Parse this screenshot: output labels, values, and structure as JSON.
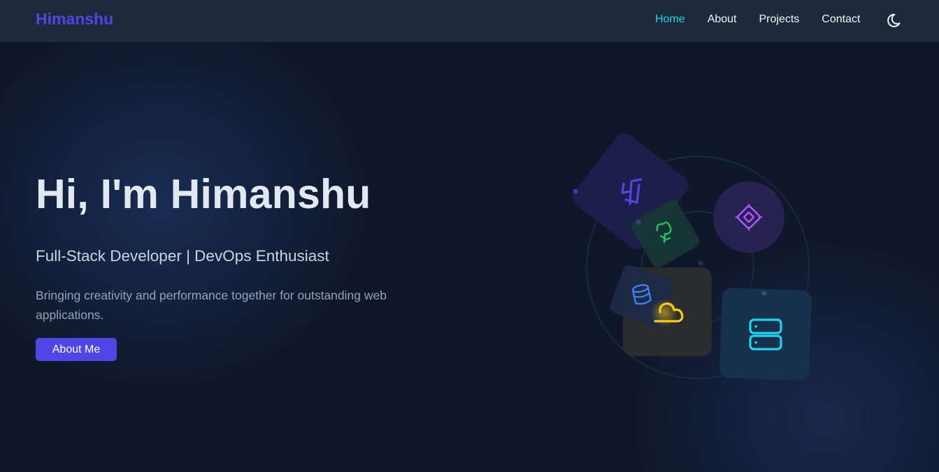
{
  "navbar": {
    "brand": "Himanshu",
    "links": [
      {
        "label": "Home",
        "active": true
      },
      {
        "label": "About",
        "active": false
      },
      {
        "label": "Projects",
        "active": false
      },
      {
        "label": "Contact",
        "active": false
      }
    ],
    "theme_toggle_icon": "moon-icon"
  },
  "hero": {
    "title": "Hi, I'm Himanshu",
    "subtitle": "Full-Stack Developer | DevOps Enthusiast",
    "description": "Bringing creativity and performance together for outstanding web applications.",
    "cta_label": "About Me"
  },
  "illustration": {
    "tiles": [
      {
        "icon": "transform-icon",
        "color": "#4f46e5"
      },
      {
        "icon": "tree-icon",
        "color": "#22c55e"
      },
      {
        "icon": "cpu-chip-icon",
        "color": "#a855f7"
      },
      {
        "icon": "database-icon",
        "color": "#3b82f6"
      },
      {
        "icon": "cloud-icon",
        "color": "#facc15"
      },
      {
        "icon": "server-icon",
        "color": "#22d3ee"
      }
    ]
  },
  "colors": {
    "background": "#0f172a",
    "navbar": "#1e293b",
    "accent": "#4f46e5",
    "active_link": "#22d3ee"
  }
}
